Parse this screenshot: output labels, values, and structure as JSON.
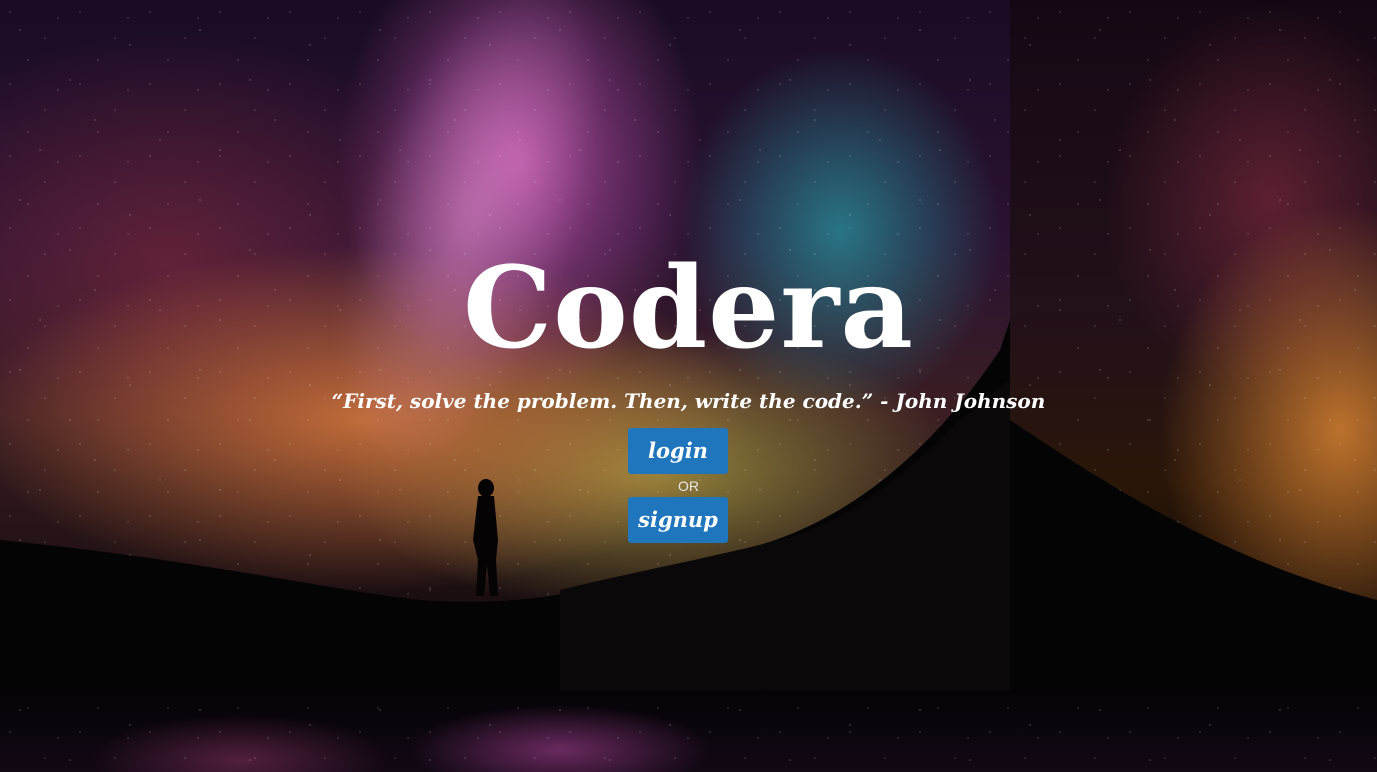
{
  "app": {
    "title": "Codera",
    "quote": "“First, solve the problem. Then, write the code.” - John Johnson"
  },
  "actions": {
    "login_label": "login",
    "separator": "OR",
    "signup_label": "signup"
  },
  "colors": {
    "button_bg": "#1f76bd",
    "text": "#ffffff"
  }
}
